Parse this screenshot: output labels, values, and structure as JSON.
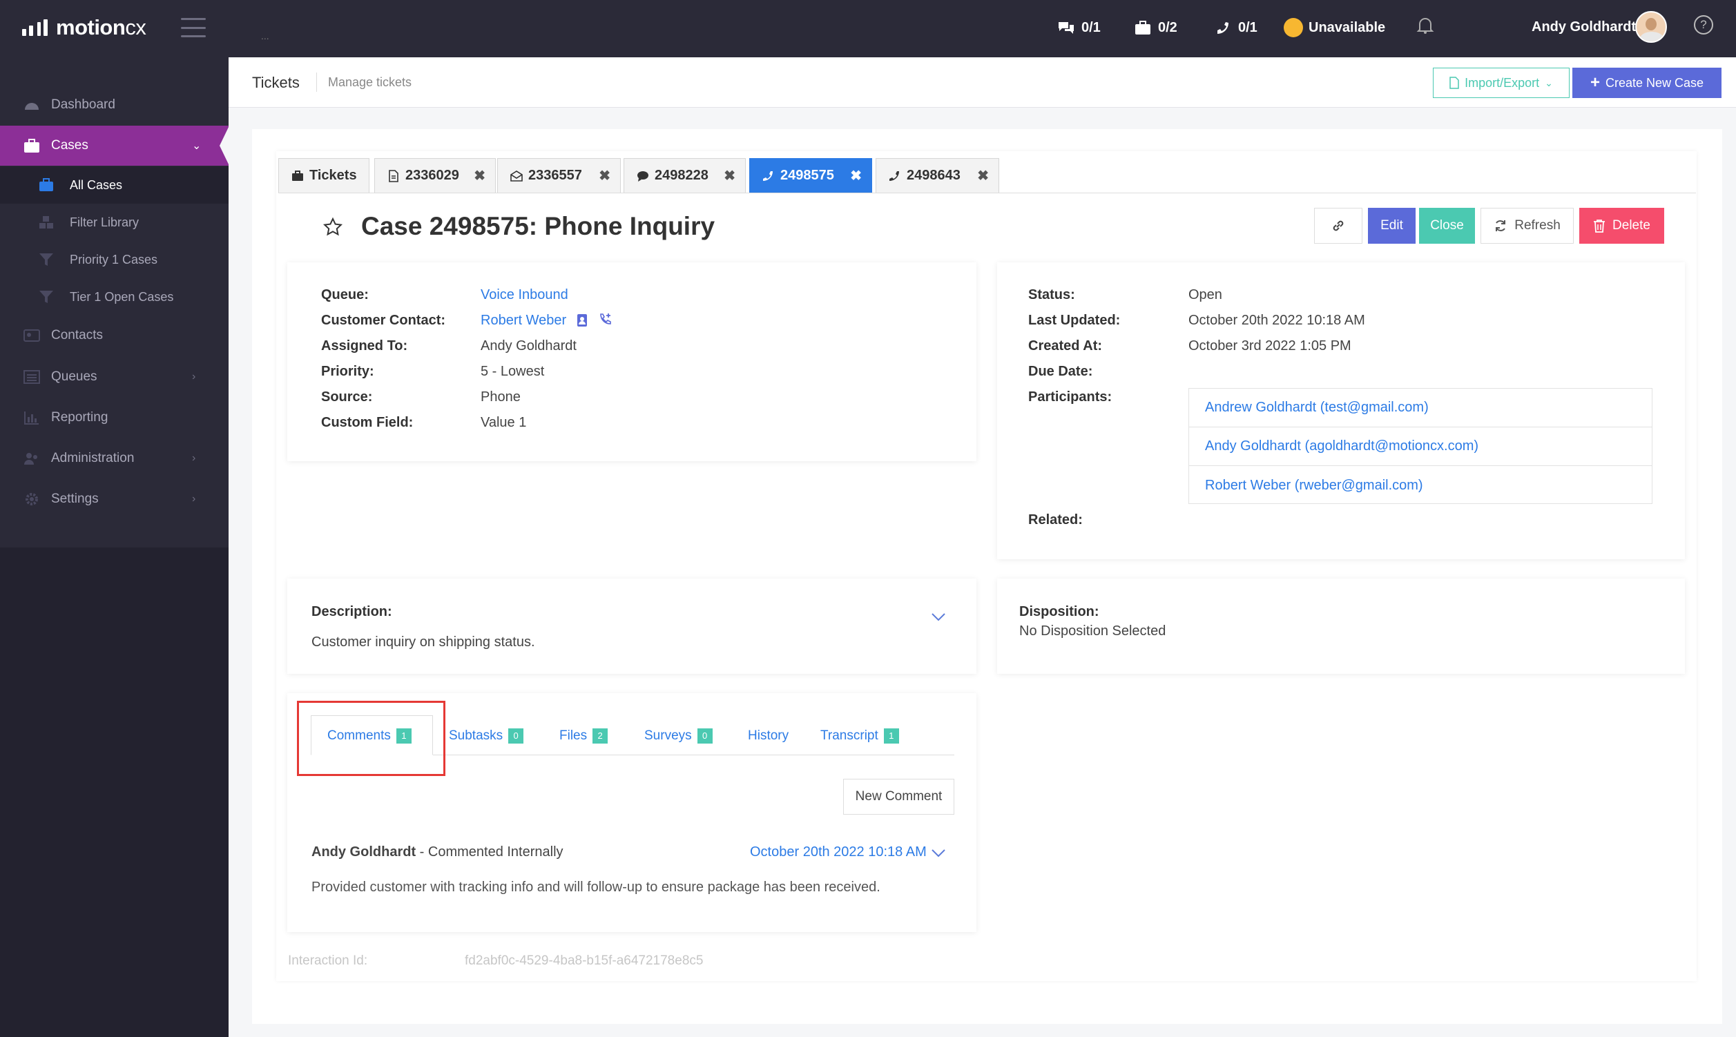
{
  "app": {
    "logo_main": "motion",
    "logo_suffix": "cx",
    "header_dots": "..."
  },
  "topbar": {
    "chats": "0/1",
    "tickets": "0/2",
    "calls": "0/1",
    "presence": "Unavailable",
    "user_name": "Andy Goldhardt",
    "help": "?"
  },
  "sidebar": {
    "items": [
      {
        "label": "Dashboard",
        "icon": "dashboard-icon"
      },
      {
        "label": "Cases",
        "icon": "briefcase-icon",
        "active": true
      },
      {
        "label": "Contacts",
        "icon": "contacts-icon"
      },
      {
        "label": "Queues",
        "icon": "list-icon"
      },
      {
        "label": "Reporting",
        "icon": "chart-icon"
      },
      {
        "label": "Administration",
        "icon": "users-icon"
      },
      {
        "label": "Settings",
        "icon": "gear-icon"
      }
    ],
    "sub_items": [
      {
        "label": "All Cases",
        "icon": "briefcase-icon",
        "active": true
      },
      {
        "label": "Filter Library",
        "icon": "cubes-icon"
      },
      {
        "label": "Priority 1 Cases",
        "icon": "filter-icon"
      },
      {
        "label": "Tier 1 Open Cases",
        "icon": "filter-icon"
      }
    ]
  },
  "page_header": {
    "title": "Tickets",
    "subtitle": "Manage tickets",
    "import_label": "Import/Export",
    "create_label": "Create New Case"
  },
  "tabs": [
    {
      "label": "Tickets",
      "icon": "briefcase-icon"
    },
    {
      "label": "2336029",
      "icon": "file-icon"
    },
    {
      "label": "2336557",
      "icon": "envelope-open-icon"
    },
    {
      "label": "2498228",
      "icon": "chat-icon"
    },
    {
      "label": "2498575",
      "icon": "phone-icon",
      "active": true
    },
    {
      "label": "2498643",
      "icon": "phone-icon"
    }
  ],
  "case": {
    "title": "Case 2498575: Phone Inquiry",
    "actions": {
      "edit": "Edit",
      "close": "Close",
      "refresh": "Refresh",
      "delete": "Delete"
    },
    "left_fields": {
      "queue_label": "Queue:",
      "queue": "Voice Inbound",
      "contact_label": "Customer Contact:",
      "contact": "Robert Weber",
      "assigned_label": "Assigned To:",
      "assigned": "Andy Goldhardt",
      "priority_label": "Priority:",
      "priority": "5 - Lowest",
      "source_label": "Source:",
      "source": "Phone",
      "custom_label": "Custom Field:",
      "custom": "Value 1"
    },
    "right_fields": {
      "status_label": "Status:",
      "status": "Open",
      "updated_label": "Last Updated:",
      "updated": "October 20th 2022 10:18 AM",
      "created_label": "Created At:",
      "created": "October 3rd 2022 1:05 PM",
      "due_label": "Due Date:",
      "participants_label": "Participants:",
      "participants": [
        "Andrew Goldhardt (test@gmail.com)",
        "Andy Goldhardt (agoldhardt@motioncx.com)",
        "Robert Weber (rweber@gmail.com)"
      ],
      "related_label": "Related:"
    },
    "description_label": "Description:",
    "description": "Customer inquiry on shipping status.",
    "disposition_label": "Disposition:",
    "disposition": "No Disposition Selected"
  },
  "subtabs": [
    {
      "label": "Comments",
      "count": "1",
      "active": true
    },
    {
      "label": "Subtasks",
      "count": "0"
    },
    {
      "label": "Files",
      "count": "2"
    },
    {
      "label": "Surveys",
      "count": "0"
    },
    {
      "label": "History"
    },
    {
      "label": "Transcript",
      "count": "1"
    }
  ],
  "comments": {
    "new_label": "New Comment",
    "items": [
      {
        "author": "Andy Goldhardt",
        "type": " - Commented Internally",
        "date": "October 20th 2022 10:18 AM",
        "body": "Provided customer with tracking info and will follow-up to ensure package has been received."
      }
    ]
  },
  "interaction": {
    "label": "Interaction Id:",
    "value": "fd2abf0c-4529-4ba8-b15f-a6472178e8c5"
  },
  "colors": {
    "sidebar_bg": "#2b2a38",
    "active_nav": "#8c2f97",
    "primary": "#5b6ad9",
    "teal": "#4bc9b1",
    "danger": "#f54d6c",
    "link": "#2c7be5",
    "presence": "#f7b731"
  }
}
